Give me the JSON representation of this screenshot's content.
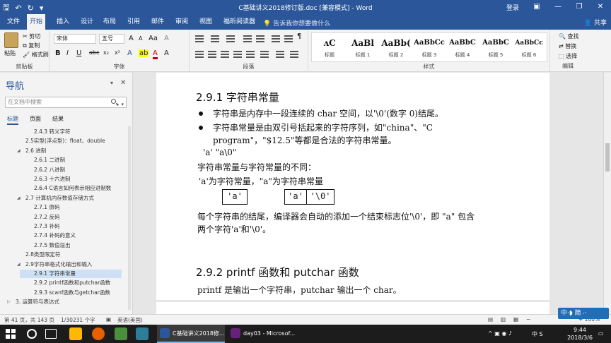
{
  "window": {
    "title": "C基础讲义2018修订版.doc [兼容模式] - Word",
    "login": "登录",
    "share": "共享"
  },
  "ribbon_tabs": [
    "文件",
    "开始",
    "插入",
    "设计",
    "布局",
    "引用",
    "邮件",
    "审阅",
    "视图",
    "福昕阅读器"
  ],
  "tell_me": "告诉我你想要做什么",
  "clipboard": {
    "paste": "粘贴",
    "cut": "剪切",
    "copy": "复制",
    "format_painter": "格式刷",
    "label": "剪贴板"
  },
  "font": {
    "name": "宋体",
    "size": "五号",
    "label": "字体",
    "buttons": [
      "B",
      "I",
      "U",
      "abc",
      "x₂",
      "x²"
    ],
    "aa_buttons": [
      "A",
      "A",
      "Aa",
      "A"
    ]
  },
  "paragraph": {
    "label": "段落"
  },
  "styles": {
    "label": "样式",
    "items": [
      {
        "sample": "ᴧC",
        "name": "标题"
      },
      {
        "sample": "AaBl",
        "name": "标题 1"
      },
      {
        "sample": "AaBb(",
        "name": "标题 2"
      },
      {
        "sample": "AaBbCc",
        "name": "标题 3"
      },
      {
        "sample": "AaBbC",
        "name": "标题 4"
      },
      {
        "sample": "AaBbC",
        "name": "标题 5"
      },
      {
        "sample": "AaBbCc",
        "name": "标题 6"
      }
    ]
  },
  "editing": {
    "find": "查找",
    "replace": "替换",
    "select": "选择",
    "label": "编辑"
  },
  "nav": {
    "title": "导航",
    "search_placeholder": "在文档中搜索",
    "tabs": [
      "标题",
      "页面",
      "结果"
    ],
    "items": [
      {
        "text": "2.4.3 转义字符",
        "indent": 3,
        "selected": false,
        "arrow": ""
      },
      {
        "text": "2.5实型(浮点型)：float、double",
        "indent": 2,
        "selected": false,
        "arrow": ""
      },
      {
        "text": "2.6 进制",
        "indent": 2,
        "selected": false,
        "arrow": "◢"
      },
      {
        "text": "2.6.1 二进制",
        "indent": 3,
        "selected": false,
        "arrow": ""
      },
      {
        "text": "2.6.2 八进制",
        "indent": 3,
        "selected": false,
        "arrow": ""
      },
      {
        "text": "2.6.3 十六进制",
        "indent": 3,
        "selected": false,
        "arrow": ""
      },
      {
        "text": "2.6.4 C语言如何表示相应进制数",
        "indent": 3,
        "selected": false,
        "arrow": ""
      },
      {
        "text": "2.7 计算机内存数值存储方式",
        "indent": 2,
        "selected": false,
        "arrow": "◢"
      },
      {
        "text": "2.7.1 原码",
        "indent": 3,
        "selected": false,
        "arrow": ""
      },
      {
        "text": "2.7.2 反码",
        "indent": 3,
        "selected": false,
        "arrow": ""
      },
      {
        "text": "2.7.3 补码",
        "indent": 3,
        "selected": false,
        "arrow": ""
      },
      {
        "text": "2.7.4 补码的意义",
        "indent": 3,
        "selected": false,
        "arrow": ""
      },
      {
        "text": "2.7.5 数值溢出",
        "indent": 3,
        "selected": false,
        "arrow": ""
      },
      {
        "text": "2.8类型限定符",
        "indent": 2,
        "selected": false,
        "arrow": ""
      },
      {
        "text": "2.9字符串格式化输出和输入",
        "indent": 2,
        "selected": false,
        "arrow": "◢"
      },
      {
        "text": "2.9.1 字符串常量",
        "indent": 3,
        "selected": true,
        "arrow": ""
      },
      {
        "text": "2.9.2 printf函数和putchar函数",
        "indent": 3,
        "selected": false,
        "arrow": ""
      },
      {
        "text": "2.9.3 scanf函数与getchar函数",
        "indent": 3,
        "selected": false,
        "arrow": ""
      },
      {
        "text": "3. 运算符与表达式",
        "indent": 1,
        "selected": false,
        "arrow": "▷"
      }
    ]
  },
  "doc": {
    "h1": "2.9.1 字符串常量",
    "b1": "字符串是内存中一段连续的 char 空间，以'\\0'(数字 0)结尾。",
    "b2a": "字符串常量是由双引号括起来的字符序列，如\"china\"、\"C",
    "b2b": "program\"，\"$12.5\"等都是合法的字符串常量。",
    "ex": "'a'  \"a\\0\"",
    "diff": "字符串常量与字符常量的不同：",
    "cmp": "'a'为字符常量，\"a\"为字符串常量",
    "box1": "'a'",
    "box2": "'a'",
    "box3": "'\\0'",
    "p1a": "每个字符串的结尾，编译器会自动的添加一个结束标志位'\\0'，即 \"a\" 包含",
    "p1b": "两个字符'a'和'\\0'。",
    "h2": "2.9.2 printf 函数和 putchar 函数",
    "p2": "printf 是输出一个字符串，putchar 输出一个 char。"
  },
  "status": {
    "page": "第 41 页，共 143 页",
    "words": "1/30231 个字",
    "lang": "英语(美国)",
    "zoom": "+ 100%"
  },
  "ime": "中·◗ 简 ⸳·",
  "taskbar": {
    "tasks": [
      "C基础讲义2018修...",
      "day03 - Microsof..."
    ],
    "tray": "中  S",
    "time": "9:44",
    "date": "2018/3/6"
  },
  "colors": {
    "word_blue": "#2b579a",
    "taskbar": "#1c1c1c"
  }
}
